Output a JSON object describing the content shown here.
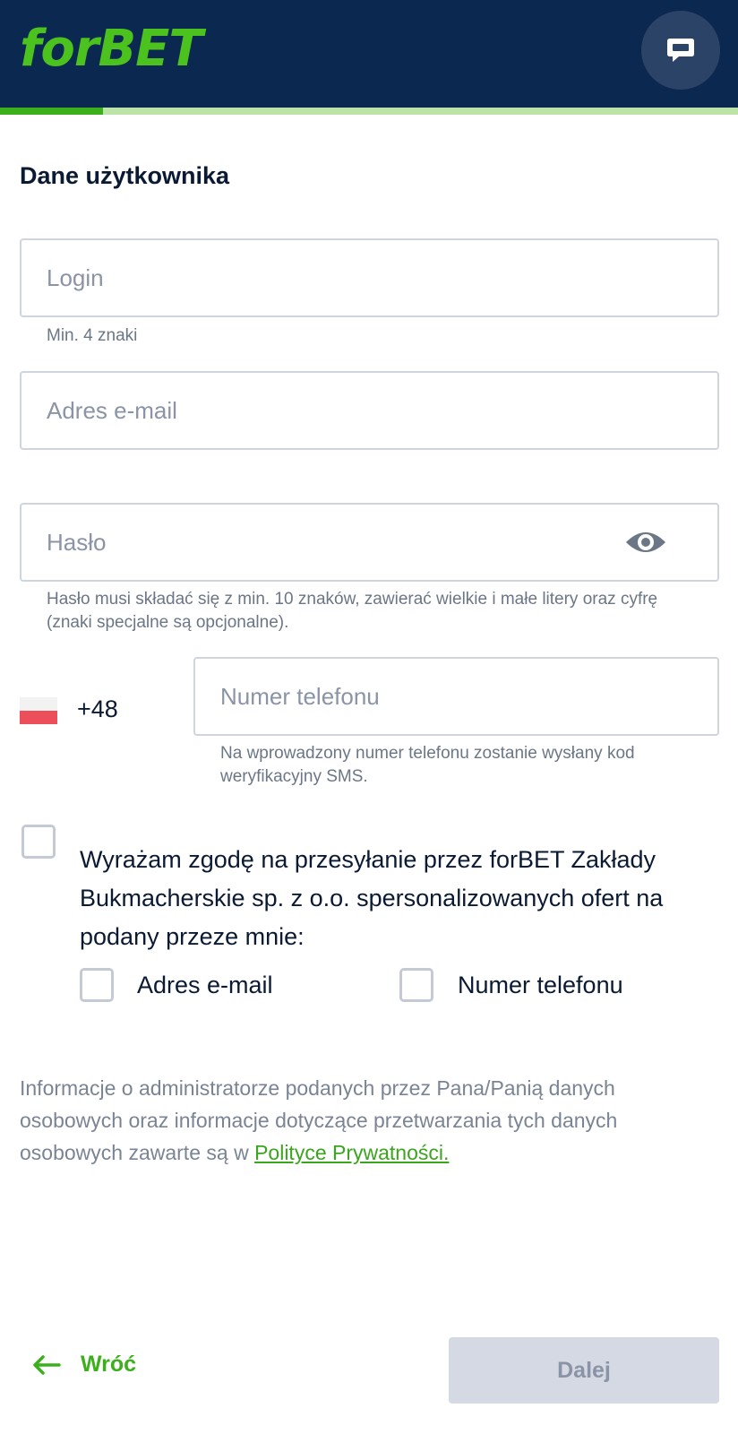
{
  "header": {
    "logo_text": "forBET",
    "brand_color": "#4cc21e",
    "bg_color": "#0a2850",
    "chat_icon": "chat-bubble-icon",
    "progress_fraction": 0.14
  },
  "form": {
    "title": "Dane użytkownika",
    "login": {
      "placeholder": "Login",
      "hint": "Min. 4 znaki"
    },
    "email": {
      "placeholder": "Adres e-mail"
    },
    "password": {
      "placeholder": "Hasło",
      "hint": "Hasło musi składać się z min. 10 znaków, zawierać wielkie i małe litery oraz cyfrę (znaki specjalne są opcjonalne).",
      "toggle_icon": "eye-icon"
    },
    "phone": {
      "country_flag": "poland-flag-icon",
      "prefix": "+48",
      "placeholder": "Numer telefonu",
      "hint": "Na wprowadzony numer telefonu zostanie wysłany kod weryfikacyjny SMS."
    }
  },
  "consent": {
    "text": "Wyrażam zgodę na przesyłanie przez forBET Zakłady Bukmacherskie sp. z o.o. spersonalizowanych ofert na podany przeze mnie:",
    "checked": false,
    "options": [
      {
        "label": "Adres e-mail",
        "checked": false
      },
      {
        "label": "Numer telefonu",
        "checked": false
      }
    ]
  },
  "info": {
    "text": "Informacje o administratorze podanych przez Pana/Panią danych osobowych oraz informacje dotyczące przetwarzania tych danych osobowych zawarte są w ",
    "link_text": "Polityce Prywatności."
  },
  "footer": {
    "back_label": "Wróć",
    "back_icon": "arrow-left-icon",
    "next_label": "Dalej"
  }
}
